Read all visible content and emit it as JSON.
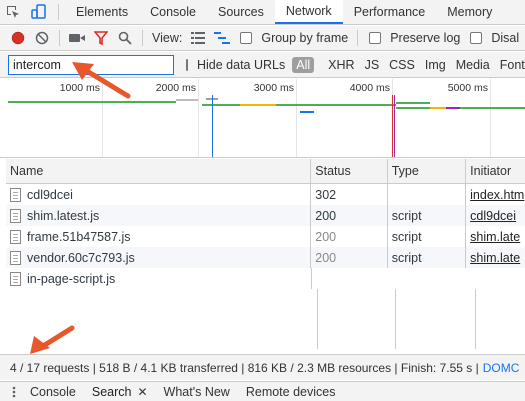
{
  "devtools": {
    "tabs": [
      {
        "label": "Elements"
      },
      {
        "label": "Console"
      },
      {
        "label": "Sources"
      },
      {
        "label": "Network"
      },
      {
        "label": "Performance"
      },
      {
        "label": "Memory"
      }
    ],
    "active_tab": "Network"
  },
  "toolbar": {
    "view_label": "View:",
    "group_by_frame": "Group by frame",
    "preserve_log": "Preserve log",
    "disable_cache": "Disal"
  },
  "filter": {
    "value": "intercom",
    "hide_data_urls": "Hide data URLs",
    "types": [
      "All",
      "XHR",
      "JS",
      "CSS",
      "Img",
      "Media",
      "Font"
    ]
  },
  "timeline": {
    "ticks": [
      "1000 ms",
      "2000 ms",
      "3000 ms",
      "4000 ms",
      "5000 ms"
    ]
  },
  "table": {
    "headers": {
      "name": "Name",
      "status": "Status",
      "type": "Type",
      "initiator": "Initiator"
    },
    "rows": [
      {
        "name": "cdl9dcei",
        "status": "302",
        "type": "",
        "initiator": "index.htm"
      },
      {
        "name": "shim.latest.js",
        "status": "200",
        "type": "script",
        "initiator": "cdl9dcei"
      },
      {
        "name": "frame.51b47587.js",
        "status": "200",
        "type": "script",
        "initiator": "shim.late"
      },
      {
        "name": "vendor.60c7c793.js",
        "status": "200",
        "type": "script",
        "initiator": "shim.late"
      },
      {
        "name": "in-page-script.js",
        "status": "",
        "type": "",
        "initiator": ""
      }
    ]
  },
  "statusbar": {
    "text": "4 / 17 requests | 518 B / 4.1 KB transferred | 816 KB / 2.3 MB resources | Finish: 7.55 s |",
    "link": "DOMC"
  },
  "drawer": {
    "tabs": [
      {
        "label": "Console"
      },
      {
        "label": "Search"
      },
      {
        "label": "What's New"
      },
      {
        "label": "Remote devices"
      }
    ]
  },
  "colors": {
    "accent": "#1a73e8",
    "record": "#d93025",
    "annotation": "#e8572a"
  }
}
